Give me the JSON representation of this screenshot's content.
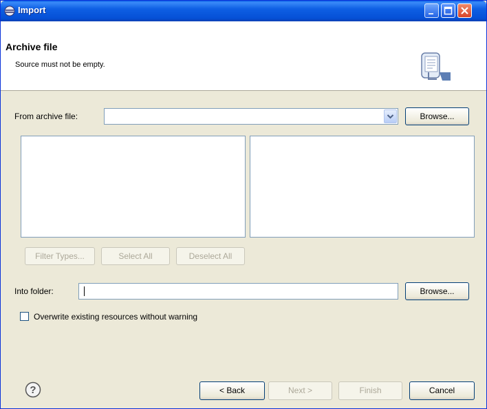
{
  "window": {
    "title": "Import"
  },
  "header": {
    "title": "Archive file",
    "message": "Source must not be empty."
  },
  "archive": {
    "label": "From archive file:",
    "value": "",
    "browse_label": "Browse..."
  },
  "filter_buttons": {
    "filter_types": "Filter Types...",
    "select_all": "Select All",
    "deselect_all": "Deselect All"
  },
  "folder": {
    "label": "Into folder:",
    "value": "",
    "browse_label": "Browse..."
  },
  "overwrite": {
    "label": "Overwrite existing resources without warning",
    "checked": false
  },
  "footer": {
    "back": "< Back",
    "next": "Next >",
    "finish": "Finish",
    "cancel": "Cancel"
  },
  "colors": {
    "titlebar": "#0a5ee6",
    "dialog_bg": "#ece9d8",
    "field_border": "#7f9db9"
  }
}
